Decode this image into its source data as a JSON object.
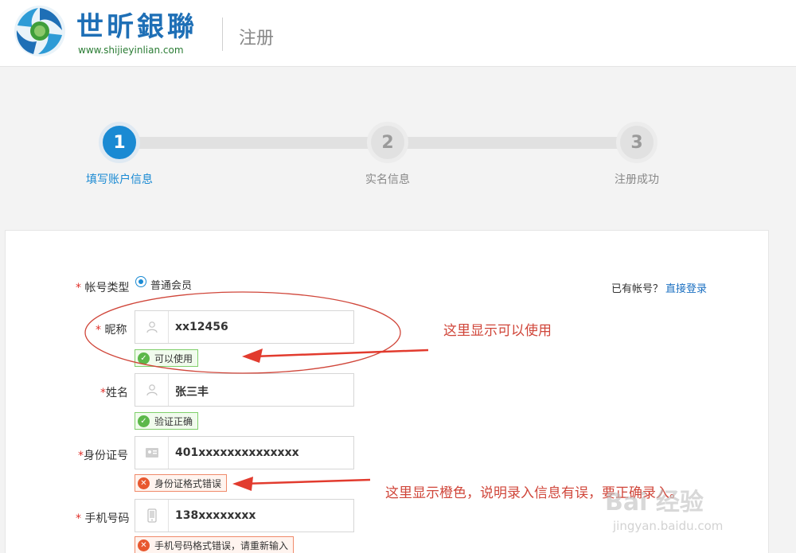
{
  "header": {
    "brand": "世昕銀聯",
    "url": "www.shijieyinlian.com",
    "title": "注册"
  },
  "steps": [
    {
      "number": "1",
      "label": "填写账户信息"
    },
    {
      "number": "2",
      "label": "实名信息"
    },
    {
      "number": "3",
      "label": "注册成功"
    }
  ],
  "form": {
    "account_type": {
      "required": "*",
      "label": "帐号类型",
      "option": "普通会员"
    },
    "login_prompt": "已有帐号？",
    "login_link": "直接登录",
    "nickname": {
      "required": "*",
      "label": "昵称",
      "value": "xx12456",
      "message": "可以使用"
    },
    "name": {
      "required": "*",
      "label": "姓名",
      "value": "张三丰",
      "message": "验证正确"
    },
    "id_number": {
      "required": "*",
      "label": "身份证号",
      "value": "401xxxxxxxxxxxxxx",
      "message": "身份证格式错误"
    },
    "phone": {
      "required": "*",
      "label": "手机号码",
      "value": "138xxxxxxxx",
      "message": "手机号码格式错误，请重新输入"
    }
  },
  "annotations": {
    "ok_note": "这里显示可以使用",
    "err_note": "这里显示橙色，说明录入信息有误，要正确录入。"
  },
  "watermark": {
    "text": "Bai 经验",
    "url": "jingyan.baidu.com"
  },
  "colors": {
    "accent": "#1a8ad3",
    "annotation": "#d0463a",
    "ok": "#5cb84a",
    "error": "#e8582f"
  }
}
